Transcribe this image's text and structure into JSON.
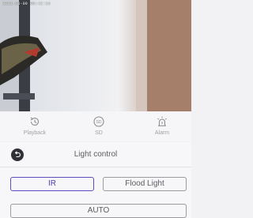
{
  "feed": {
    "osd_text": "2023-08-09 08:42:15"
  },
  "toolbar": {
    "items": [
      {
        "label": "Playback",
        "icon": "playback-icon"
      },
      {
        "label": "SD",
        "icon": "sd-card-icon"
      },
      {
        "label": "Alarm",
        "icon": "alarm-icon"
      }
    ]
  },
  "light_control": {
    "title": "Light control",
    "buttons": {
      "ir": "IR",
      "flood": "Flood Light",
      "auto": "AUTO"
    },
    "selected": "IR",
    "accent_color": "#5b4fc0"
  }
}
